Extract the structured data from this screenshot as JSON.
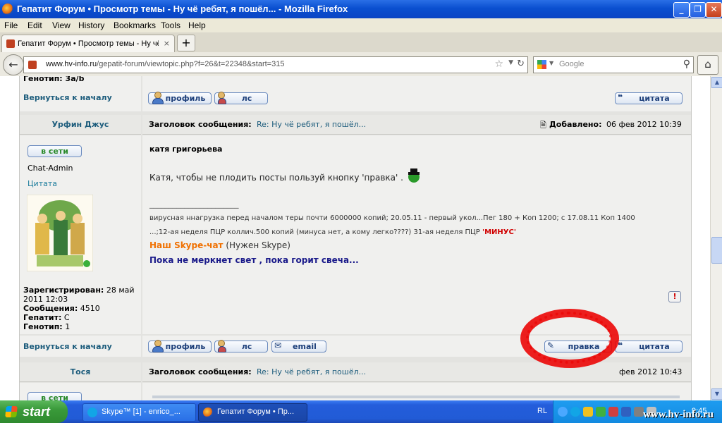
{
  "window": {
    "title": "Гепатит Форум • Просмотр темы - Ну чё ребят, я пошёл... - Mozilla Firefox",
    "buttons": {
      "minimize": "_",
      "maximize": "❐",
      "close": "✕"
    }
  },
  "menu": [
    "File",
    "Edit",
    "View",
    "History",
    "Bookmarks",
    "Tools",
    "Help"
  ],
  "tab": {
    "label": "Гепатит Форум • Просмотр темы - Ну чё р...",
    "close": "×",
    "new_tab": "+"
  },
  "nav": {
    "url_host": "www.hv-info.ru",
    "url_path": "/gepatit-forum/viewtopic.php?f=26&t=22348&start=315",
    "search_placeholder": "Google",
    "icons": {
      "back": "arrow-left",
      "bookmark": "star-outline",
      "reload": "reload",
      "search": "magnifier",
      "home": "house"
    }
  },
  "page": {
    "top_partial_text": "Генотип: 3a/b",
    "back_to_top": "Вернуться к началу",
    "buttons": {
      "profile": "профиль",
      "pm": "лс",
      "quote": "цитата",
      "email": "email",
      "edit": "правка"
    },
    "post": {
      "author": "Урфин Джус",
      "online": "в сети",
      "rank": "Chat-Admin",
      "quote_link": "Цитата",
      "registered_label": "Зарегистрирован:",
      "registered_value": "28 май 2011 12:03",
      "messages_label": "Сообщения:",
      "messages_value": "4510",
      "hepatitis_label": "Гепатит:",
      "hepatitis_value": "C",
      "genotype_label": "Генотип:",
      "genotype_value": "1",
      "subject_label": "Заголовок сообщения:",
      "subject_value": "Re: Ну чё ребят, я пошёл...",
      "added_label": "Добавлено:",
      "added_value": "06 фев 2012 10:39",
      "addressee": "катя григорьева",
      "body": "Катя, чтобы не плодить посты пользуй кнопку 'правка' .",
      "signature_divider": "_______________________",
      "signature_line1": "вирусная ннагрузка перед началом теры почти 6000000 копий; 20.05.11 - первый укол...Пег 180 + Коп 1200; с 17.08.11 Коп 1400",
      "signature_line2_prefix": "...;12-ая неделя ПЦР коллич.500 копий (минуса нет, а кому легко????) 31-ая неделя ПЦР ",
      "signature_line2_red": "'МИНУС'",
      "skype_chat_link": "Наш Skype-чат",
      "skype_note": "(Нужен Skype)",
      "motto": "Пока не меркнет свет , пока горит свеча..."
    },
    "next_post": {
      "author": "Тося",
      "online": "в сети",
      "subject_label": "Заголовок сообщения:",
      "subject_value": "Re: Ну чё ребят, я пошёл...",
      "added_value": "фев 2012 10:43"
    }
  },
  "taskbar": {
    "start": "start",
    "items": [
      {
        "label": "Skype™ [1] - enrico_..."
      },
      {
        "label": "Гепатит Форум • Пр..."
      }
    ],
    "tray_lang": "RL",
    "clock": "9:45"
  },
  "watermark": "www.hv-info.ru",
  "colors": {
    "annotation_red": "#eb0000",
    "link": "#1c5c7c",
    "taskbar": "#245ddb"
  }
}
